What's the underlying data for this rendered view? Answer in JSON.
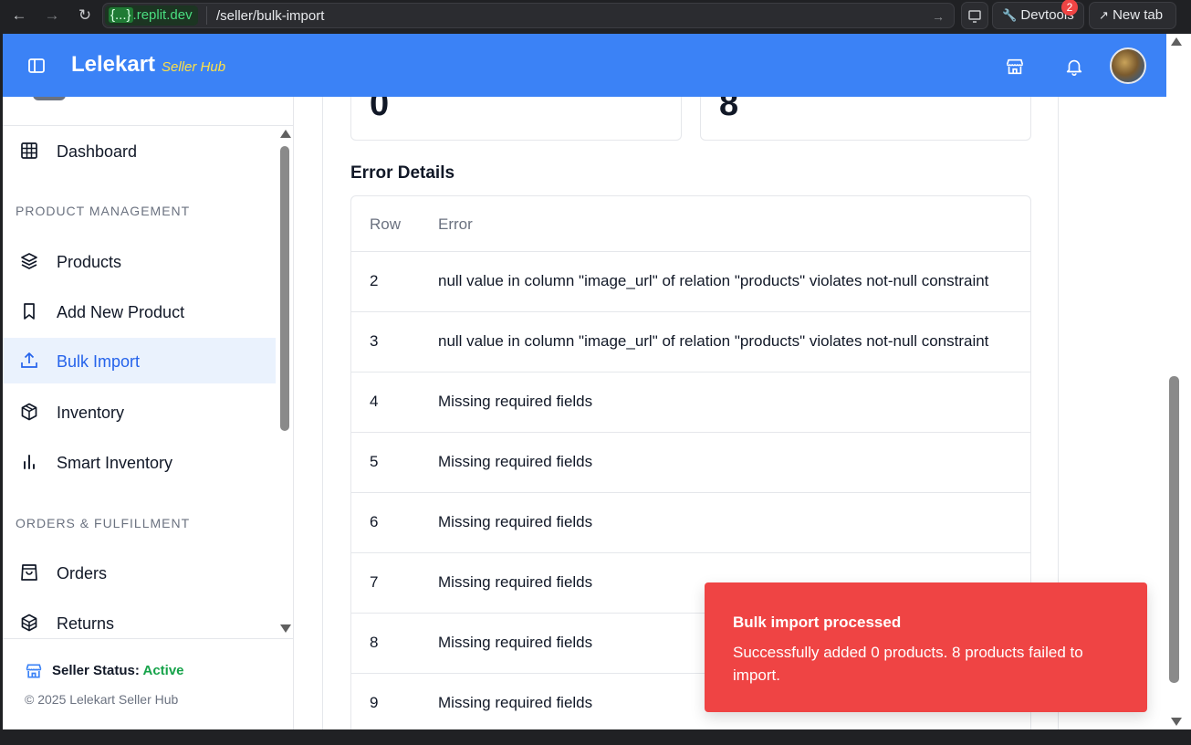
{
  "browser": {
    "url_prefix_braces": "{...}",
    "url_domain": ".replit.dev",
    "url_path": "/seller/bulk-import",
    "devtools_label": "Devtools",
    "devtools_badge": "2",
    "new_tab_label": "New tab"
  },
  "header": {
    "brand": "Lelekart",
    "brand_sub": "Seller Hub"
  },
  "sidebar": {
    "dashboard": "Dashboard",
    "section_product": "PRODUCT MANAGEMENT",
    "products": "Products",
    "add_new_product": "Add New Product",
    "bulk_import": "Bulk Import",
    "inventory": "Inventory",
    "smart_inventory": "Smart Inventory",
    "section_orders": "ORDERS & FULFILLMENT",
    "orders": "Orders",
    "returns": "Returns",
    "seller_status_label": "Seller Status:",
    "seller_status_value": "Active",
    "copyright": "© 2025 Lelekart Seller Hub"
  },
  "stats": {
    "successful": "0",
    "failed": "8"
  },
  "errors": {
    "title": "Error Details",
    "col_row": "Row",
    "col_error": "Error",
    "rows": [
      {
        "row": "2",
        "error": "null value in column \"image_url\" of relation \"products\" violates not-null constraint"
      },
      {
        "row": "3",
        "error": "null value in column \"image_url\" of relation \"products\" violates not-null constraint"
      },
      {
        "row": "4",
        "error": "Missing required fields"
      },
      {
        "row": "5",
        "error": "Missing required fields"
      },
      {
        "row": "6",
        "error": "Missing required fields"
      },
      {
        "row": "7",
        "error": "Missing required fields"
      },
      {
        "row": "8",
        "error": "Missing required fields"
      },
      {
        "row": "9",
        "error": "Missing required fields"
      }
    ]
  },
  "toast": {
    "title": "Bulk import processed",
    "description": "Successfully added 0 products. 8 products failed to import."
  },
  "colors": {
    "primary": "#3b82f6",
    "toast": "#ef4444",
    "active_status": "#16a34a"
  }
}
